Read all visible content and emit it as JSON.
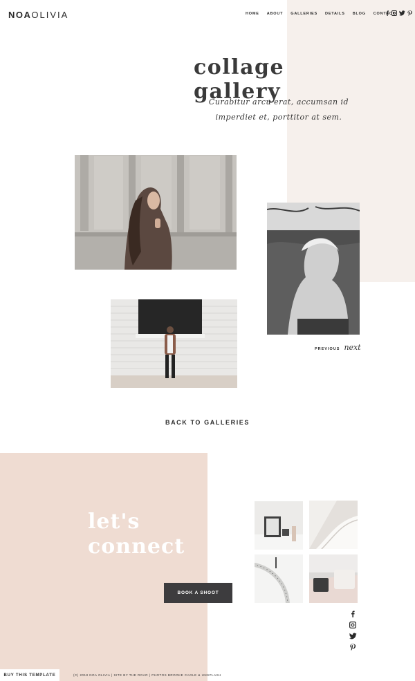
{
  "header": {
    "logo_part1": "NOA",
    "logo_part2": "OLIVIA",
    "nav": [
      "HOME",
      "ABOUT",
      "GALLERIES",
      "DETAILS",
      "BLOG",
      "CONTACT"
    ],
    "social_icons": [
      "facebook-icon",
      "instagram-icon",
      "twitter-icon",
      "pinterest-icon"
    ]
  },
  "hero": {
    "title": "collage gallery",
    "subtitle": "Curabitur arcu erat, accumsan id imperdiet et, porttitor at sem."
  },
  "pager": {
    "previous": "PREVIOUS",
    "next": "next"
  },
  "back_link": "BACK TO GALLERIES",
  "connect": {
    "line1": "let's",
    "line2": "connect",
    "button": "BOOK A SHOOT"
  },
  "side_social_icons": [
    "facebook-icon",
    "instagram-icon",
    "twitter-icon",
    "pinterest-icon"
  ],
  "footer": {
    "buy_button": "BUY THIS TEMPLATE",
    "credits": "(C) 2018 NOA OLIVIA | SITE BY THE ROAR | PHOTOS BROOKE CAGLE & UNSPLASH"
  },
  "colors": {
    "cream_block": "#f6f0ec",
    "pink_block": "#efdcd2",
    "dark_button": "#3d3c3e",
    "text": "#2b2b2b"
  }
}
